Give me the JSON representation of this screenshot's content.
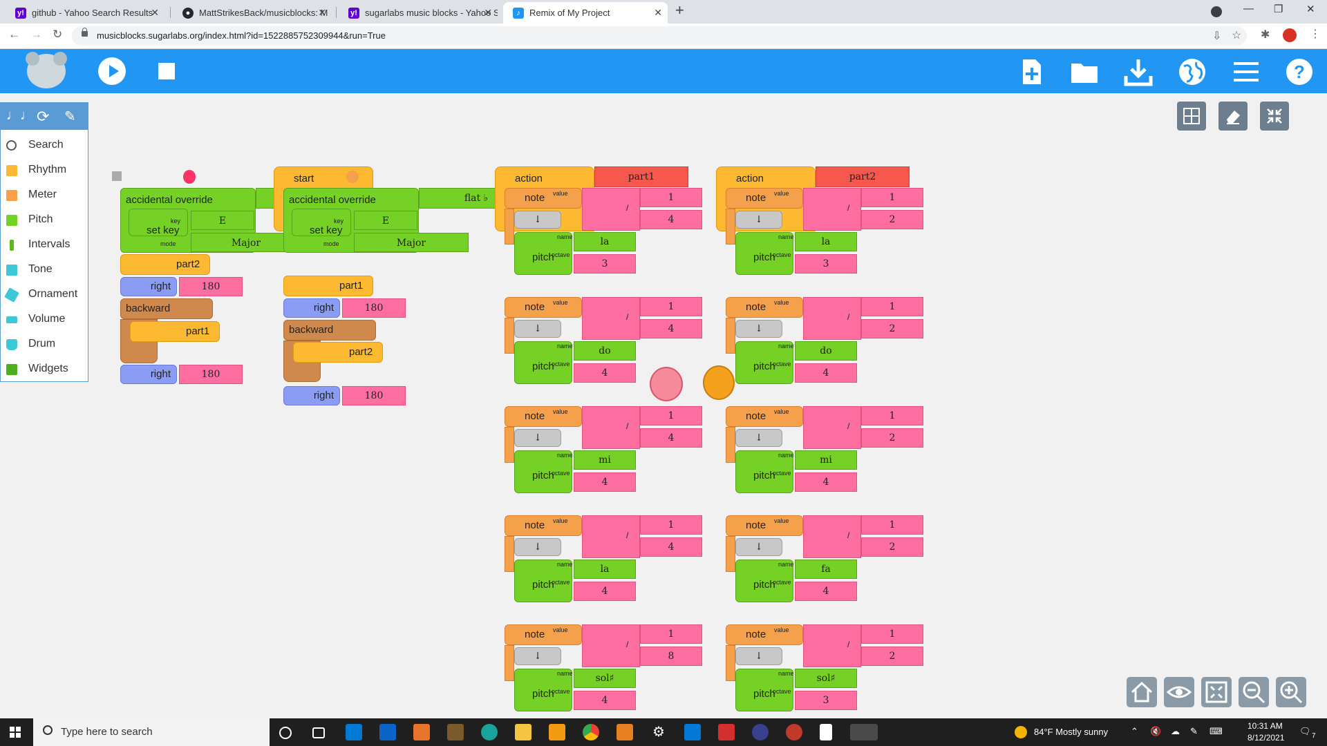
{
  "browser": {
    "tabs": [
      {
        "title": "github - Yahoo Search Results",
        "icon": "yahoo-icon",
        "active": false
      },
      {
        "title": "MattStrikesBack/musicblocks: M",
        "icon": "github-icon",
        "active": false
      },
      {
        "title": "sugarlabs music blocks - Yahoo S",
        "icon": "yahoo-icon",
        "active": false
      },
      {
        "title": "Remix of My Project",
        "icon": "musicblocks-icon",
        "active": true
      }
    ],
    "url": "musicblocks.sugarlabs.org/index.html?id=1522885752309944&run=True"
  },
  "palette": {
    "items": [
      {
        "label": "Search",
        "icon": "search-icon",
        "color": "#555555"
      },
      {
        "label": "Rhythm",
        "icon": "rhythm-icon",
        "color": "#fdb931"
      },
      {
        "label": "Meter",
        "icon": "meter-icon",
        "color": "#fdb931"
      },
      {
        "label": "Pitch",
        "icon": "pitch-icon",
        "color": "#76d126"
      },
      {
        "label": "Intervals",
        "icon": "intervals-icon",
        "color": "#76d126"
      },
      {
        "label": "Tone",
        "icon": "tone-icon",
        "color": "#3ec6d9"
      },
      {
        "label": "Ornament",
        "icon": "ornament-icon",
        "color": "#3ec6d9"
      },
      {
        "label": "Volume",
        "icon": "volume-icon",
        "color": "#3ec6d9"
      },
      {
        "label": "Drum",
        "icon": "drum-icon",
        "color": "#3ec6d9"
      },
      {
        "label": "Widgets",
        "icon": "widgets-icon",
        "color": "#76d126"
      }
    ]
  },
  "blocks": {
    "acc_label": "accidental override",
    "setkey_label": "set key",
    "key_label": "key",
    "mode_label": "mode",
    "key_value": "E",
    "mode_value": "Major",
    "flat_label": "flat ♭",
    "start_label": "start",
    "action_label": "action",
    "part1": "part1",
    "part2": "part2",
    "right_label": "right",
    "backward_label": "backward",
    "angle": "180",
    "note_label": "note",
    "value_label": "value",
    "pitch_label": "pitch",
    "name_label": "name",
    "octave_label": "octave",
    "div_sign": "/",
    "arrow": "↓",
    "numerator": "1",
    "part1_notes": [
      {
        "denom": "4",
        "pitch": "la",
        "octave": "3"
      },
      {
        "denom": "4",
        "pitch": "do",
        "octave": "4"
      },
      {
        "denom": "4",
        "pitch": "mi",
        "octave": "4"
      },
      {
        "denom": "4",
        "pitch": "la",
        "octave": "4"
      },
      {
        "denom": "8",
        "pitch": "sol♯",
        "octave": "4"
      }
    ],
    "part2_notes": [
      {
        "denom": "2",
        "pitch": "la",
        "octave": "3"
      },
      {
        "denom": "2",
        "pitch": "do",
        "octave": "4"
      },
      {
        "denom": "2",
        "pitch": "mi",
        "octave": "4"
      },
      {
        "denom": "2",
        "pitch": "fa",
        "octave": "4"
      },
      {
        "denom": "2",
        "pitch": "sol♯",
        "octave": "3"
      }
    ]
  },
  "taskbar": {
    "search_placeholder": "Type here to search",
    "weather": "84°F  Mostly sunny",
    "time": "10:31 AM",
    "date": "8/12/2021",
    "notifications": "7"
  },
  "colors": {
    "toolbar": "#2196f3",
    "pitch_green": "#76d126",
    "rhythm_orange": "#f5a04a",
    "number_pink": "#ff6ea1",
    "flow_yellow": "#fdb931",
    "action_red": "#f6584d"
  }
}
